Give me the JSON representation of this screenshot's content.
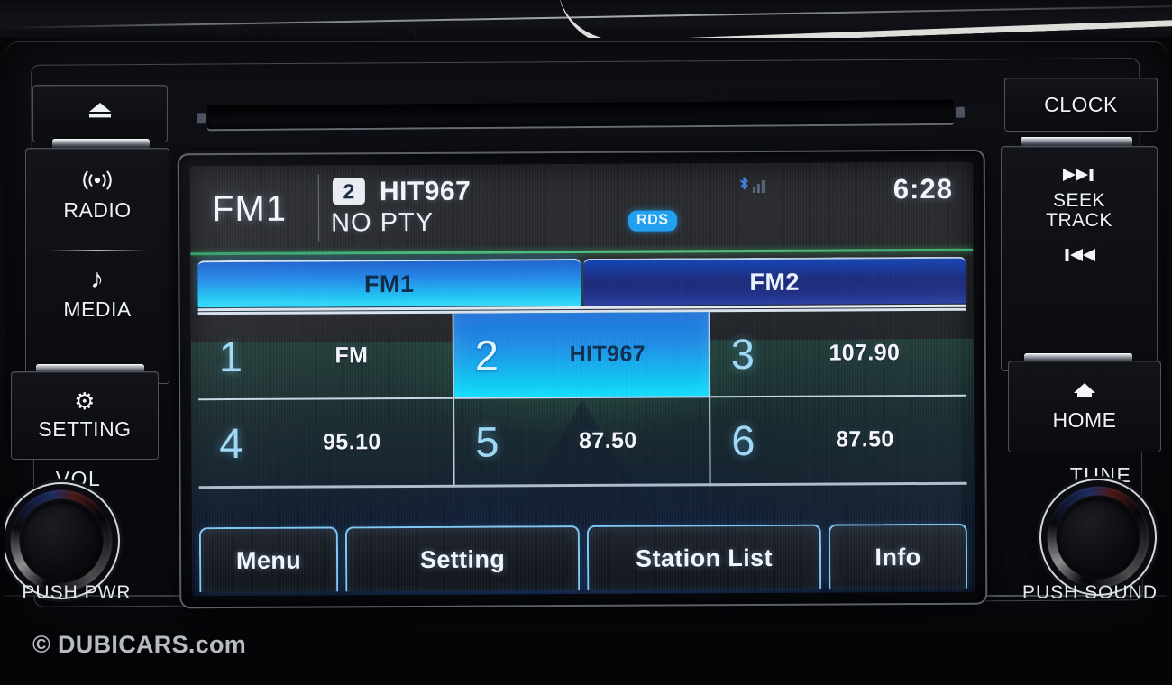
{
  "watermark": "© DUBICARS.com",
  "left_panel": {
    "eject": {
      "name": "Eject",
      "glyph": "▲"
    },
    "radio": {
      "label": "RADIO",
      "icon": "radio-waves-icon"
    },
    "media": {
      "label": "MEDIA",
      "glyph": "♪"
    },
    "setting": {
      "label": "SETTING",
      "glyph": "⚙"
    },
    "volume": {
      "label": "VOL",
      "sub_label": "PUSH PWR"
    }
  },
  "right_panel": {
    "clock_button": {
      "label": "CLOCK"
    },
    "seek_track": {
      "label_line1": "SEEK",
      "label_line2": "TRACK",
      "forward_glyph": "▶▶❙",
      "back_glyph": "❙◀◀"
    },
    "home": {
      "label": "HOME",
      "icon": "home-icon"
    },
    "tune": {
      "label": "TUNE",
      "sub_label": "PUSH SOUND"
    }
  },
  "screen": {
    "status": {
      "band": "FM1",
      "preset_number": "2",
      "station_name": "HIT967",
      "pty": "NO PTY",
      "rds_badge": "RDS",
      "bluetooth_icon": "bluetooth-icon",
      "clock": "6:28"
    },
    "tabs": [
      {
        "label": "FM1",
        "active": true
      },
      {
        "label": "FM2",
        "active": false
      }
    ],
    "presets": [
      {
        "number": "1",
        "value": "FM",
        "selected": false
      },
      {
        "number": "2",
        "value": "HIT967",
        "selected": true
      },
      {
        "number": "3",
        "value": "107.90",
        "selected": false
      },
      {
        "number": "4",
        "value": "95.10",
        "selected": false
      },
      {
        "number": "5",
        "value": "87.50",
        "selected": false
      },
      {
        "number": "6",
        "value": "87.50",
        "selected": false
      }
    ],
    "soft_keys": [
      {
        "label": "Menu"
      },
      {
        "label": "Setting"
      },
      {
        "label": "Station List"
      },
      {
        "label": "Info"
      }
    ]
  },
  "colors": {
    "accent_cyan": "#08dcfb",
    "accent_blue": "#1a6fd8",
    "rds_blue": "#1f9ff0",
    "green_rule": "#49b972",
    "preset_number": "#9fd8f6"
  }
}
